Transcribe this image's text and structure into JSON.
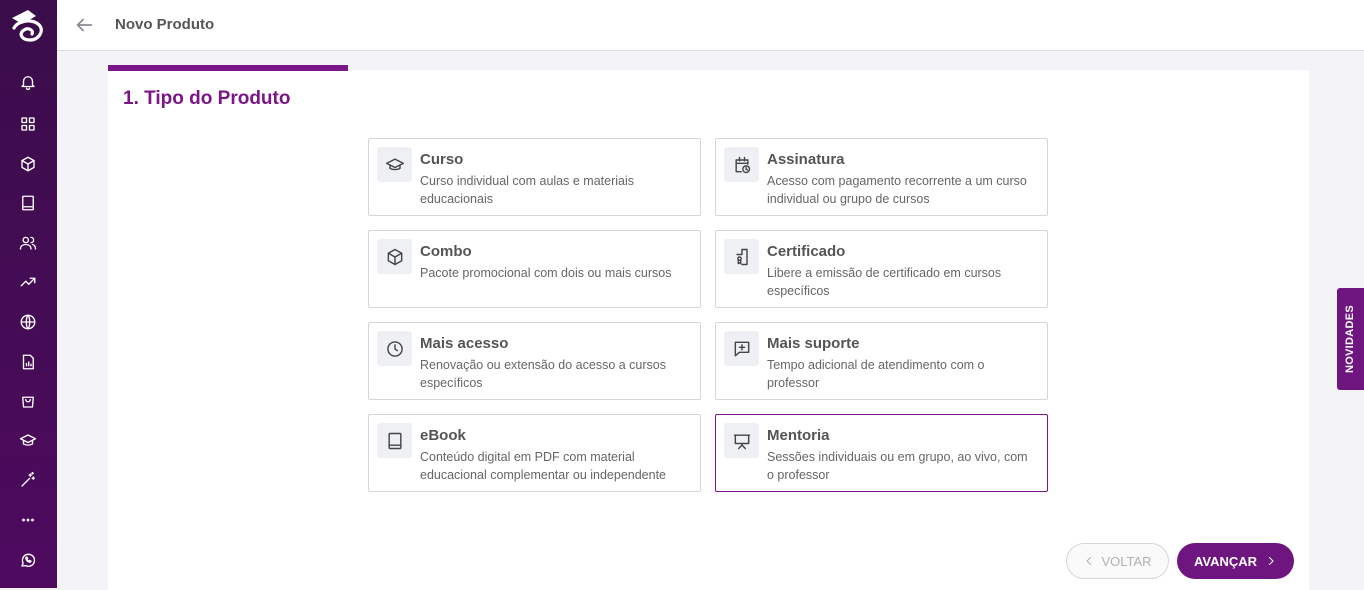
{
  "header": {
    "title": "Novo Produto"
  },
  "step": {
    "title": "1. Tipo do Produto"
  },
  "options": [
    {
      "name": "Curso",
      "desc": "Curso individual com aulas e materiais educacionais",
      "icon": "graduation-cap-icon"
    },
    {
      "name": "Assinatura",
      "desc": "Acesso com pagamento recorrente a um curso individual ou grupo de cursos",
      "icon": "calendar-clock-icon"
    },
    {
      "name": "Combo",
      "desc": "Pacote promocional com dois ou mais cursos",
      "icon": "box-icon"
    },
    {
      "name": "Certificado",
      "desc": "Libere a emissão de certificado em cursos específicos",
      "icon": "certificate-icon"
    },
    {
      "name": "Mais acesso",
      "desc": "Renovação ou extensão do acesso a cursos específicos",
      "icon": "clock-icon"
    },
    {
      "name": "Mais suporte",
      "desc": "Tempo adicional de atendimento com o professor",
      "icon": "chat-plus-icon"
    },
    {
      "name": "eBook",
      "desc": "Conteúdo digital em PDF com material educacional complementar ou independente",
      "icon": "book-icon"
    },
    {
      "name": "Mentoria",
      "desc": "Sessões individuais ou em grupo, ao vivo, com o professor",
      "icon": "presentation-icon"
    }
  ],
  "selected_option": "Mentoria",
  "buttons": {
    "back": "VOLTAR",
    "next": "AVANÇAR"
  },
  "side_tab": "NOVIDADES",
  "colors": {
    "primary": "#6e1580",
    "sidebar": "#4e0a5f"
  }
}
